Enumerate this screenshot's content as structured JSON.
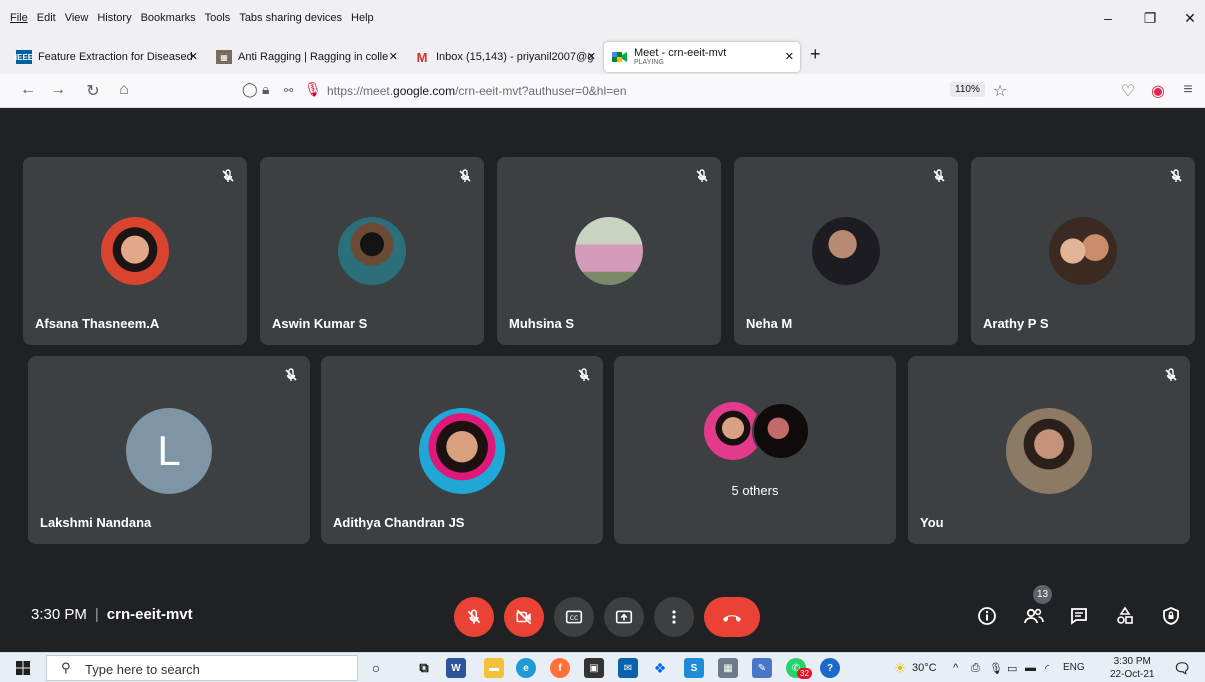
{
  "menubar": {
    "items": [
      "File",
      "Edit",
      "View",
      "History",
      "Bookmarks",
      "Tools",
      "Tabs sharing devices",
      "Help"
    ]
  },
  "tabs": [
    {
      "title": "Feature Extraction for Diseased ",
      "favicon": "ieee-icon"
    },
    {
      "title": "Anti Ragging | Ragging in colle",
      "favicon": "college-icon"
    },
    {
      "title": "Inbox (15,143) - priyanil2007@g",
      "favicon": "gmail-icon"
    },
    {
      "title": "Meet - crn-eeit-mvt",
      "subtitle": "PLAYING",
      "favicon": "meet-icon"
    }
  ],
  "navbar": {
    "url_prefix": "https://meet.",
    "url_domain": "google.com",
    "url_rest": "/crn-eeit-mvt?authuser=0&hl=en",
    "zoom": "110%"
  },
  "participants_row1": [
    {
      "name": "Afsana Thasneem.A"
    },
    {
      "name": "Aswin Kumar S"
    },
    {
      "name": "Muhsina S"
    },
    {
      "name": "Neha M"
    },
    {
      "name": "Arathy P S"
    }
  ],
  "participants_row2": [
    {
      "name": "Lakshmi Nandana",
      "initial": "L"
    },
    {
      "name": "Adithya Chandran JS"
    },
    {
      "name": "",
      "others_label": "5 others"
    },
    {
      "name": "You"
    }
  ],
  "meetbar": {
    "time": "3:30 PM",
    "separator": "|",
    "meeting_code": "crn-eeit-mvt",
    "participant_count": "13"
  },
  "taskbar": {
    "search_placeholder": "Type here to search",
    "weather": "30°C",
    "language": "ENG",
    "time": "3:30 PM",
    "date": "22-Oct-21",
    "notification_badge": "32"
  },
  "colors": {
    "meet_bg": "#202124",
    "tile_bg": "#3c4043",
    "danger": "#ea4335"
  }
}
